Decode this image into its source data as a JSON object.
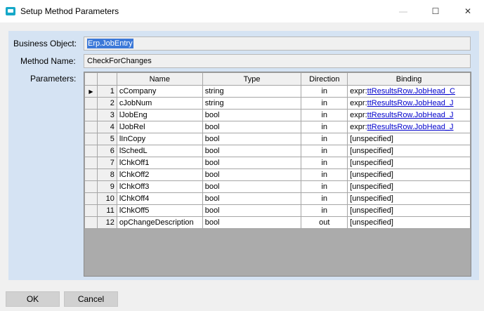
{
  "window": {
    "title": "Setup Method Parameters",
    "minimize_glyph": "—",
    "maximize_glyph": "☐",
    "close_glyph": "✕"
  },
  "form": {
    "business_object_label": "Business Object:",
    "business_object_value": "Erp.JobEntry",
    "method_name_label": "Method Name:",
    "method_name_value": "CheckForChanges",
    "parameters_label": "Parameters:"
  },
  "grid": {
    "columns": [
      "Name",
      "Type",
      "Direction",
      "Binding"
    ],
    "current_row_indicator": "▶",
    "rows": [
      {
        "num": "1",
        "name": "cCompany",
        "type": "string",
        "direction": "in",
        "binding_prefix": "expr:",
        "binding": "ttResultsRow.JobHead_C"
      },
      {
        "num": "2",
        "name": "cJobNum",
        "type": "string",
        "direction": "in",
        "binding_prefix": "expr:",
        "binding": "ttResultsRow.JobHead_J"
      },
      {
        "num": "3",
        "name": "lJobEng",
        "type": "bool",
        "direction": "in",
        "binding_prefix": "expr:",
        "binding": "ttResultsRow.JobHead_J"
      },
      {
        "num": "4",
        "name": "lJobRel",
        "type": "bool",
        "direction": "in",
        "binding_prefix": "expr:",
        "binding": "ttResultsRow.JobHead_J"
      },
      {
        "num": "5",
        "name": "lInCopy",
        "type": "bool",
        "direction": "in",
        "binding_prefix": "",
        "binding": "[unspecified]"
      },
      {
        "num": "6",
        "name": "lSchedL",
        "type": "bool",
        "direction": "in",
        "binding_prefix": "",
        "binding": "[unspecified]"
      },
      {
        "num": "7",
        "name": "lChkOff1",
        "type": "bool",
        "direction": "in",
        "binding_prefix": "",
        "binding": "[unspecified]"
      },
      {
        "num": "8",
        "name": "lChkOff2",
        "type": "bool",
        "direction": "in",
        "binding_prefix": "",
        "binding": "[unspecified]"
      },
      {
        "num": "9",
        "name": "lChkOff3",
        "type": "bool",
        "direction": "in",
        "binding_prefix": "",
        "binding": "[unspecified]"
      },
      {
        "num": "10",
        "name": "lChkOff4",
        "type": "bool",
        "direction": "in",
        "binding_prefix": "",
        "binding": "[unspecified]"
      },
      {
        "num": "11",
        "name": "lChkOff5",
        "type": "bool",
        "direction": "in",
        "binding_prefix": "",
        "binding": "[unspecified]"
      },
      {
        "num": "12",
        "name": "opChangeDescription",
        "type": "bool",
        "direction": "out",
        "binding_prefix": "",
        "binding": "[unspecified]"
      }
    ]
  },
  "buttons": {
    "ok": "OK",
    "cancel": "Cancel"
  },
  "colors": {
    "panel": "#d5e3f3",
    "selection": "#3b78d8",
    "link": "#0000cc",
    "app_icon": "#16a8c8"
  },
  "icons": {
    "app": "app-window-icon",
    "row_indicator": "triangle-right-icon"
  }
}
